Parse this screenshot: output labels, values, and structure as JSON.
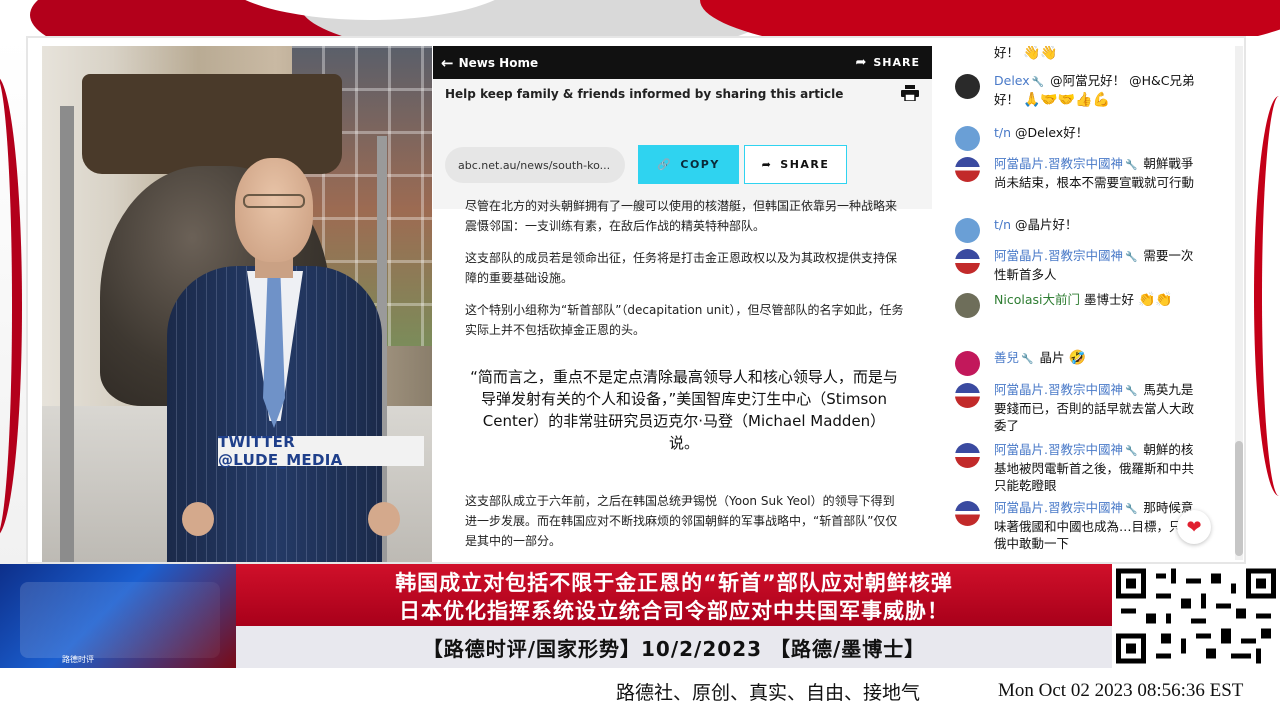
{
  "photo": {
    "twitter_tag": "TWITTER  @LUDE_MEDIA"
  },
  "article": {
    "nav": {
      "back_label": "News Home",
      "share_label": "SHARE"
    },
    "share_box": {
      "heading": "Help keep family & friends informed by sharing this article",
      "url": "abc.net.au/news/south-ko...",
      "copy_label": "COPY",
      "share_label": "SHARE"
    },
    "paragraphs": [
      "尽管在北方的对头朝鲜拥有了一艘可以使用的核潜艇，但韩国正依靠另一种战略来震慑邻国：一支训练有素，在敌后作战的精英特种部队。",
      "这支部队的成员若是领命出征，任务将是打击金正恩政权以及为其政权提供支持保障的重要基础设施。",
      "这个特别小组称为“斩首部队”（decapitation unit），但尽管部队的名字如此，任务实际上并不包括砍掉金正恩的头。"
    ],
    "quote": "“简而言之，重点不是定点清除最高领导人和核心领导人，而是与导弹发射有关的个人和设备，”美国智库史汀生中心（Stimson Center）的非常驻研究员迈克尔·马登（Michael Madden）说。",
    "paragraph_last": "这支部队成立于六年前，之后在韩国总统尹锡悦（Yoon Suk Yeol）的领导下得到进一步发展。而在韩国应对不断找麻烦的邻国朝鲜的军事战略中，“斩首部队”仅仅是其中的一部分。"
  },
  "chat": {
    "messages": [
      {
        "user": "",
        "text": "好！",
        "emoji": "👋👋"
      },
      {
        "user": "Delex",
        "text": "@阿當兄好！ @H&C兄弟好！",
        "emoji": "🙏🤝🤝👍💪"
      },
      {
        "user": "t/n",
        "text": "@Delex好！",
        "emoji": ""
      },
      {
        "user": "阿當晶片.習教宗中國神",
        "text": "朝鮮戰爭尚未結束，根本不需要宣戰就可行動",
        "emoji": ""
      },
      {
        "user": "t/n",
        "text": "@晶片好！",
        "emoji": ""
      },
      {
        "user": "阿當晶片.習教宗中國神",
        "text": "需要一次性斬首多人",
        "emoji": ""
      },
      {
        "user": "Nicolasi大前门",
        "text": "墨博士好",
        "emoji": "👏👏"
      },
      {
        "user": "善兒",
        "text": "晶片",
        "emoji": "🤣"
      },
      {
        "user": "阿當晶片.習教宗中國神",
        "text": "馬英九是要錢而已，否則的話早就去當人大政委了",
        "emoji": ""
      },
      {
        "user": "阿當晶片.習教宗中國神",
        "text": "朝鮮的核基地被閃電斬首之後，俄羅斯和中共只能乾瞪眼",
        "emoji": ""
      },
      {
        "user": "阿當晶片.習教宗中國神",
        "text": "那時候意味著俄國和中國也成為…目標，只要俄中敢動一下",
        "emoji": ""
      }
    ],
    "badge": "🔧",
    "heart": "❤"
  },
  "lower_third": {
    "headline_1": "韩国成立对包括不限于金正恩的“斩首”部队应对朝鲜核弹",
    "headline_2": "日本优化指挥系统设立统合司令部应对中共国军事威胁！",
    "subline": "【路德时评/国家形势】10/2/2023 【路德/墨博士】",
    "logo_label": "路德时评"
  },
  "footer": {
    "slogan": "路德社、原创、真实、自由、接地气",
    "timestamp": "Mon Oct 02 2023 08:56:36 EST"
  }
}
